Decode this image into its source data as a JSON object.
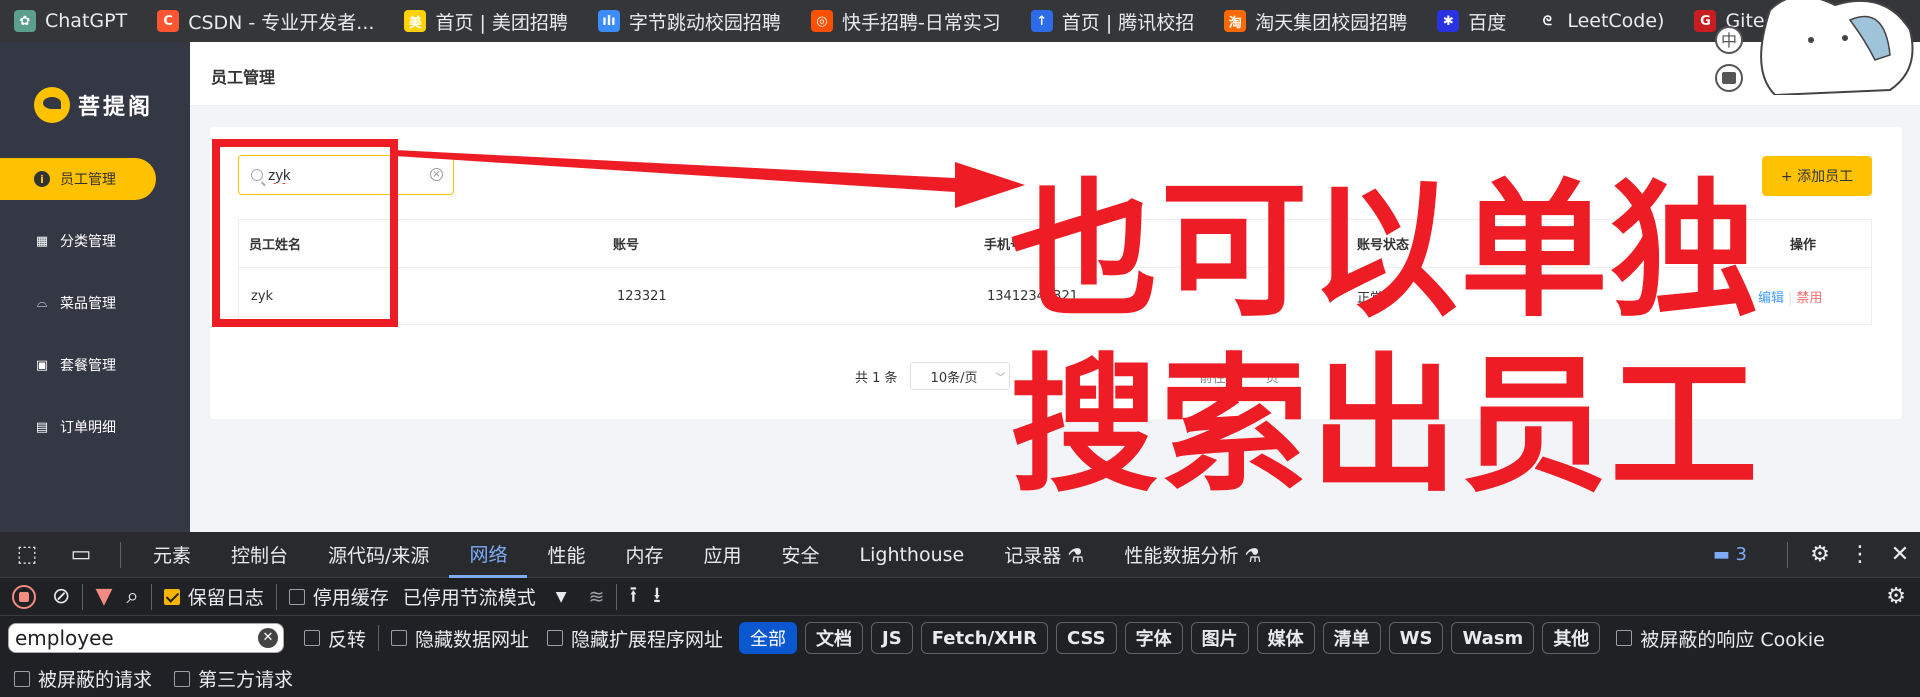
{
  "bookmarks": [
    {
      "label": "ChatGPT",
      "icon": "chatgpt-icon",
      "color": "#5aa08d",
      "glyph": "✿"
    },
    {
      "label": "CSDN - 专业开发者...",
      "icon": "csdn-icon",
      "color": "#fc5531",
      "glyph": "C"
    },
    {
      "label": "首页 | 美团招聘",
      "icon": "meituan-icon",
      "color": "#ffd100",
      "glyph": "美"
    },
    {
      "label": "字节跳动校园招聘",
      "icon": "bytedance-icon",
      "color": "#3c8cff",
      "glyph": "ılı"
    },
    {
      "label": "快手招聘-日常实习",
      "icon": "kuaishou-icon",
      "color": "#ff5000",
      "glyph": "◎"
    },
    {
      "label": "首页 | 腾讯校招",
      "icon": "tencent-icon",
      "color": "#2c6ce8",
      "glyph": "↑"
    },
    {
      "label": "淘天集团校园招聘",
      "icon": "taotian-icon",
      "color": "#ff6a00",
      "glyph": "淘"
    },
    {
      "label": "百度",
      "icon": "baidu-icon",
      "color": "#2932e1",
      "glyph": "✱"
    },
    {
      "label": "LeetCode)",
      "icon": "leetcode-icon",
      "color": "#35363a",
      "glyph": "ᘓ"
    },
    {
      "label": "Gitee.c",
      "icon": "gitee-icon",
      "color": "#c71d23",
      "glyph": "G"
    }
  ],
  "brand": {
    "name": "菩提阁",
    "accent": "#ffc200"
  },
  "sidebar": {
    "items": [
      {
        "label": "员工管理",
        "icon": "info-icon",
        "glyph": "i",
        "active": true
      },
      {
        "label": "分类管理",
        "icon": "grid-icon",
        "glyph": "▦"
      },
      {
        "label": "菜品管理",
        "icon": "dish-cover-icon",
        "glyph": "⌓"
      },
      {
        "label": "套餐管理",
        "icon": "gift-icon",
        "glyph": "▣"
      },
      {
        "label": "订单明细",
        "icon": "clipboard-icon",
        "glyph": "▤"
      }
    ]
  },
  "header": {
    "title": "员工管理"
  },
  "search": {
    "value": "zyk"
  },
  "add_button": {
    "label": "+ 添加员工"
  },
  "table": {
    "columns": [
      "员工姓名",
      "账号",
      "手机号",
      "账号状态",
      "操作"
    ],
    "rows": [
      {
        "name": "zyk",
        "account": "123321",
        "phone": "13412344321",
        "status": "正常",
        "edit": "编辑",
        "disable": "禁用"
      }
    ]
  },
  "pagination": {
    "total": "共 1 条",
    "page_size": "10条/页",
    "goto": "前往",
    "page_unit": "页"
  },
  "annotation": {
    "line1": "也可以单独",
    "line2": "搜索出员工",
    "color": "#ee1c25"
  },
  "devtools": {
    "tabs": [
      "元素",
      "控制台",
      "源代码/来源",
      "网络",
      "性能",
      "内存",
      "应用",
      "安全",
      "Lighthouse",
      "记录器 ⚗",
      "性能数据分析 ⚗"
    ],
    "active_tab": "网络",
    "issues_count": "3",
    "toolbar": {
      "preserve_log": "保留日志",
      "disable_cache": "停用缓存",
      "throttle": "已停用节流模式"
    },
    "filter": {
      "value": "employee",
      "invert": "反转",
      "hide_data_urls": "隐藏数据网址",
      "hide_extension_urls": "隐藏扩展程序网址",
      "types": [
        "全部",
        "文档",
        "JS",
        "Fetch/XHR",
        "CSS",
        "字体",
        "图片",
        "媒体",
        "清单",
        "WS",
        "Wasm",
        "其他"
      ],
      "blocked_cookies": "被屏蔽的响应 Cookie",
      "blocked_requests": "被屏蔽的请求",
      "third_party": "第三方请求"
    }
  }
}
